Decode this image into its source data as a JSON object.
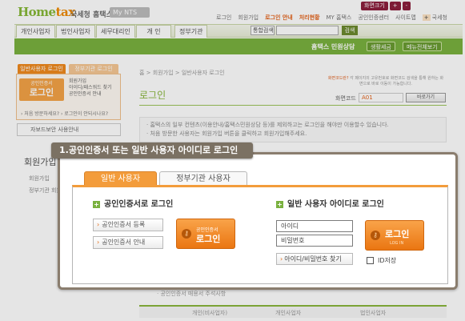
{
  "header": {
    "logo_main": "Home",
    "logo_tax": "tax",
    "logo_service": "국세청 홈택스",
    "mynts": "My NTS",
    "font_buttons": [
      "화면크기",
      "+",
      "-"
    ],
    "top_links": [
      "로그인",
      "회원가입",
      "로그인 안내",
      "처리현황",
      "MY 홈택스",
      "공인인증센터",
      "사이트맵",
      "국세청"
    ],
    "zoom_key": "+"
  },
  "nav": {
    "items": [
      "개인사업자",
      "법인사업자",
      "세무대리인",
      "개 인",
      "정부기관"
    ],
    "search_select": "통합검색",
    "search_placeholder": "",
    "search_button": "검색"
  },
  "subnav": {
    "center_label": "홈택스 민원상담",
    "pills": [
      "생활세금",
      "메뉴전체보기"
    ]
  },
  "sidebar": {
    "mini_tabs": [
      "일반사용자 로그인",
      "정부기관 로그인"
    ],
    "mini_button_small": "공인인증서",
    "mini_button_big": "로그인",
    "mini_links": [
      "회원가입",
      "아이디/패스워드 찾기",
      "공인인증서 안내"
    ],
    "mini_footer": "› 처음 방문하세요?    › 로그인이 안되시나요?",
    "biz_mode": "자보드보안 사용안내",
    "title": "회원가입",
    "items": [
      "회원가입",
      "정부기관 회원가입"
    ]
  },
  "main": {
    "breadcrumb": "홈  >  회원가입  >  일반사용자 로그인",
    "title": "로그인",
    "help_line1": "화면코드란?",
    "help_line2": "각 페이지의 고유번호로 화면코드 검색을 통해 원하는 화면으로 바로 이동이 가능합니다.",
    "code_label": "화면코드",
    "code_value": "A01",
    "code_button": "바로가기",
    "notice_lines": [
      "· 홈택스의 일부 컨텐츠(이용안내/홈택스민원상담 등)를 제외하고는 로그인을 해야만 이용할수 있습니다.",
      "· 처음 방문한 사용자는 회원가입 버튼을 클릭하고 회원가입해주세요."
    ],
    "table_caption": "· 공인인증서 매용서 주석사항",
    "table_cols": [
      "개인(비사업자)",
      "개인사업자",
      "법인사업자"
    ]
  },
  "overlay": {
    "callout": "1.공인인증서 또는 일반 사용자 아이디로 로그인",
    "tab_general": "일반 사용자",
    "tab_gov": "정부기관 사용자",
    "cert_section_title": "공인인증서로 로그인",
    "cert_register_button": "공인인증서 등록",
    "cert_guide_button": "공인인증서 안내",
    "cert_login_small": "공인인증서",
    "cert_login_big": "로그인",
    "user_section_title": "일반 사용자 아이디로 로그인",
    "id_field": "아이디",
    "password_field": "비밀번호",
    "find_button": "아이디/비밀번호 찾기",
    "user_login_big": "로그인",
    "user_login_small": "LOG IN",
    "save_id_label": "ID저장",
    "arrow": "›",
    "plus": "+",
    "key": "⚷"
  }
}
